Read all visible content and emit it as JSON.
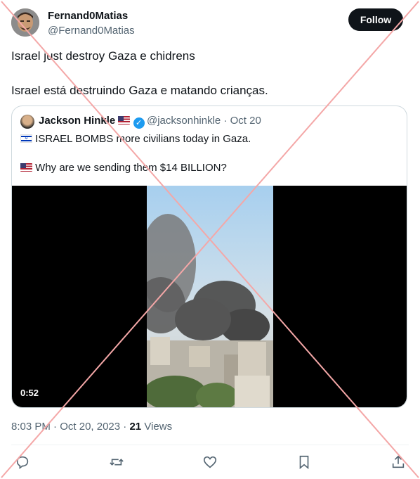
{
  "author": {
    "name": "Fernand0Matias",
    "handle": "@Fernand0Matias",
    "avatar_icon": "profile-avatar"
  },
  "follow_label": "Follow",
  "tweet": {
    "line1": "Israel just destroy Gaza e chidrens",
    "line2": "Israel está destruindo Gaza e matando crianças."
  },
  "quoted": {
    "name": "Jackson Hinkle",
    "name_flag_icon": "us-flag-icon",
    "verified_icon": "verified-badge-icon",
    "handle": "@jacksonhinkle",
    "separator": "·",
    "date": "Oct 20",
    "line1_flag_icon": "israel-flag-icon",
    "line1": "ISRAEL BOMBS more civilians today in Gaza.",
    "line2_flag_icon": "us-flag-icon",
    "line2": "Why are we sending them $14 BILLION?",
    "video_duration": "0:52"
  },
  "meta": {
    "time": "8:03 PM",
    "separator": " · ",
    "date": "Oct 20, 2023",
    "views_count": "21",
    "views_label": "Views"
  },
  "actions": [
    "reply-icon",
    "retweet-icon",
    "like-icon",
    "bookmark-icon",
    "share-icon"
  ],
  "colors": {
    "overlay_x": "#f4a7a7",
    "follow_bg": "#0f1419",
    "verified": "#1d9bf0",
    "secondary_text": "#536471"
  }
}
